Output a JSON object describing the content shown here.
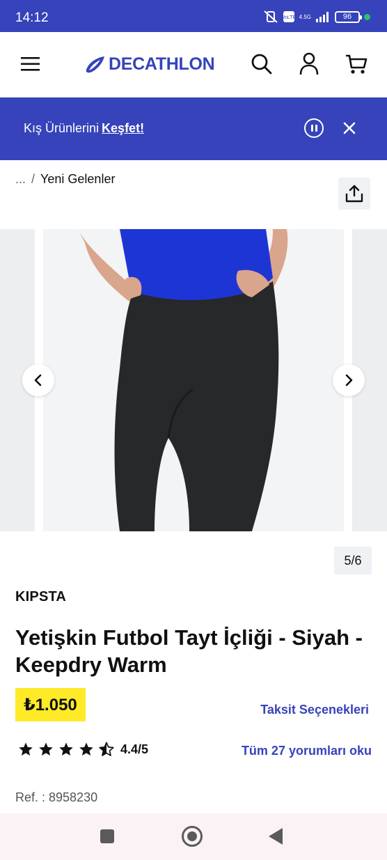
{
  "status_bar": {
    "time": "14:12",
    "network": "4.5G",
    "battery": "96"
  },
  "header": {
    "logo_text": "DECATHLON",
    "icons": [
      "menu-icon",
      "search-icon",
      "account-icon",
      "cart-icon"
    ]
  },
  "promo": {
    "text": "Kış Ürünlerini",
    "link": "Keşfet!"
  },
  "breadcrumb": {
    "ellipsis": "...",
    "separator": "/",
    "current": "Yeni Gelenler"
  },
  "gallery": {
    "counter": "5/6"
  },
  "product": {
    "brand": "KIPSTA",
    "title": "Yetişkin Futbol Tayt İçliği - Siyah - Keepdry Warm",
    "price": "₺1.050",
    "installment_link": "Taksit Seçenekleri",
    "rating": "4.4/5",
    "rating_stars": 4.5,
    "reviews_link": "Tüm 27 yorumları oku",
    "ref": "Ref. : 8958230"
  },
  "colors": {
    "brand_blue": "#3643ba",
    "price_yellow": "#ffea28"
  }
}
